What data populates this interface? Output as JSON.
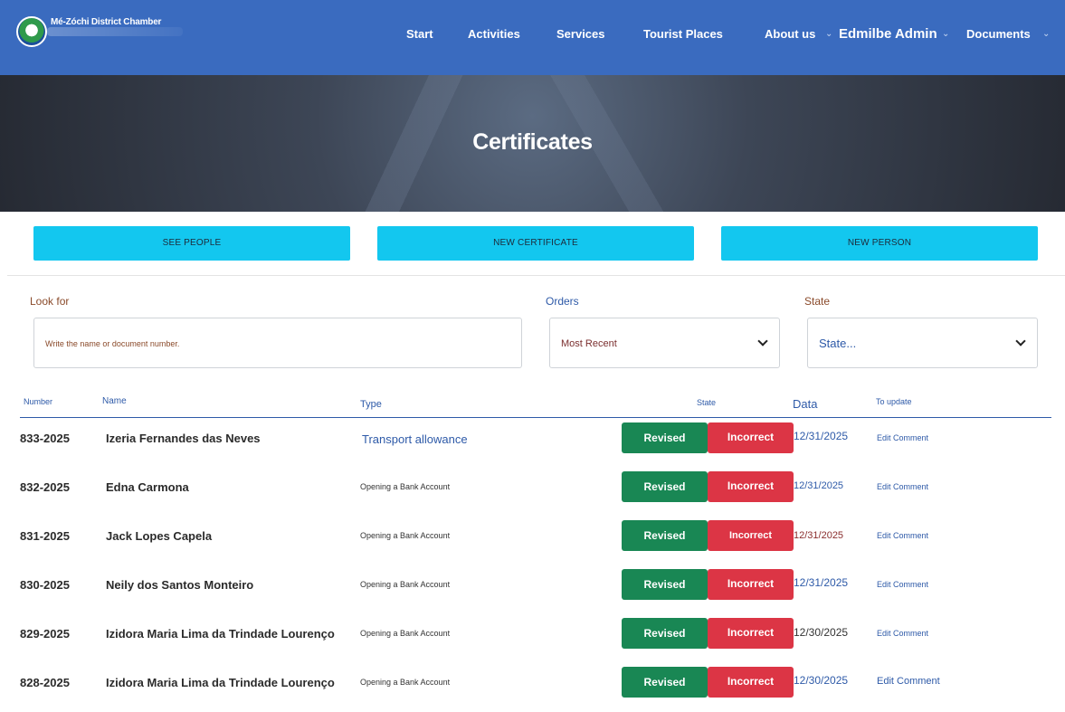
{
  "brand": {
    "name": "Mé-Zóchi District Chamber"
  },
  "nav": {
    "start": "Start",
    "activities": "Activities",
    "services": "Services",
    "tourist_places": "Tourist Places",
    "about": "About us",
    "admin": "Edmilbe Admin",
    "documents": "Documents"
  },
  "hero": {
    "title": "Certificates"
  },
  "actions": {
    "see_people": "SEE PEOPLE",
    "new_certificate": "NEW CERTIFICATE",
    "new_person": "NEW PERSON"
  },
  "filters": {
    "look_for_label": "Look for",
    "look_for_placeholder": "Write the name or document number.",
    "orders_label": "Orders",
    "orders_value": "Most Recent",
    "state_label": "State",
    "state_value": "State..."
  },
  "table": {
    "headers": {
      "number": "Number",
      "name": "Name",
      "type": "Type",
      "state": "State",
      "data": "Data",
      "update": "To update"
    },
    "rows": [
      {
        "number": "833-2025",
        "name": "Izeria Fernandes das Neves",
        "type": "Transport allowance",
        "revised": "Revised",
        "incorrect": "Incorrect",
        "date": "12/31/2025",
        "edit": "Edit Comment"
      },
      {
        "number": "832-2025",
        "name": "Edna Carmona",
        "type": "Opening a Bank Account",
        "revised": "Revised",
        "incorrect": "Incorrect",
        "date": "12/31/2025",
        "edit": "Edit Comment"
      },
      {
        "number": "831-2025",
        "name": "Jack Lopes Capela",
        "type": "Opening a Bank Account",
        "revised": "Revised",
        "incorrect": "Incorrect",
        "date": "12/31/2025",
        "edit": "Edit Comment"
      },
      {
        "number": "830-2025",
        "name": "Neily dos Santos Monteiro",
        "type": "Opening a Bank Account",
        "revised": "Revised",
        "incorrect": "Incorrect",
        "date": "12/31/2025",
        "edit": "Edit Comment"
      },
      {
        "number": "829-2025",
        "name": "Izidora Maria Lima da Trindade Lourenço",
        "type": "Opening a Bank Account",
        "revised": "Revised",
        "incorrect": "Incorrect",
        "date": "12/30/2025",
        "edit": "Edit Comment"
      },
      {
        "number": "828-2025",
        "name": "Izidora Maria Lima da Trindade Lourenço",
        "type": "Opening a Bank Account",
        "revised": "Revised",
        "incorrect": "Incorrect",
        "date": "12/30/2025",
        "edit": "Edit Comment"
      }
    ]
  },
  "colors": {
    "nav_bg": "#3a6bbf",
    "action_bg": "#13c7ef",
    "revised": "#198754",
    "incorrect": "#dc3545",
    "link": "#2e5aa8"
  }
}
